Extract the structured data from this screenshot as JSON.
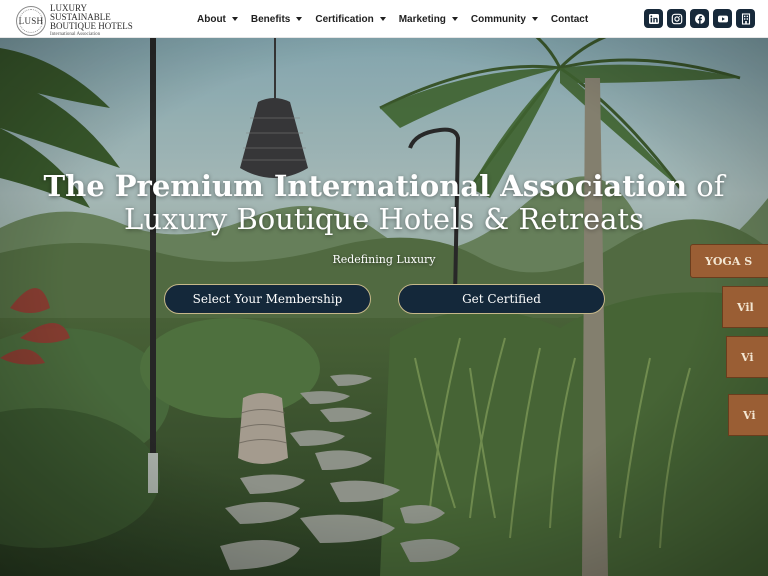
{
  "brand": {
    "seal": "LUSH",
    "line1": "LUXURY",
    "line2": "SUSTAINABLE",
    "line3": "BOUTIQUE HOTELS",
    "line4": "International Association"
  },
  "nav": {
    "items": [
      {
        "label": "About",
        "dropdown": true
      },
      {
        "label": "Benefits",
        "dropdown": true
      },
      {
        "label": "Certification",
        "dropdown": true
      },
      {
        "label": "Marketing",
        "dropdown": true
      },
      {
        "label": "Community",
        "dropdown": true
      },
      {
        "label": "Contact",
        "dropdown": false
      }
    ]
  },
  "socials": [
    "linkedin-icon",
    "instagram-icon",
    "facebook-icon",
    "youtube-icon",
    "directory-icon"
  ],
  "hero": {
    "title_strong": "The Premium International Association",
    "title_light": " of",
    "title_line2": "Luxury Boutique Hotels & Retreats",
    "subtitle": "Redefining Luxury",
    "cta_membership": "Select Your Membership",
    "cta_certified": "Get Certified",
    "signs": [
      "YOGA S",
      "Vil",
      "Vi",
      "Vi"
    ]
  },
  "colors": {
    "header_bg": "#ffffff",
    "button_bg": "#14283a",
    "button_border": "#c6b88a",
    "social_bg": "#17293a"
  }
}
